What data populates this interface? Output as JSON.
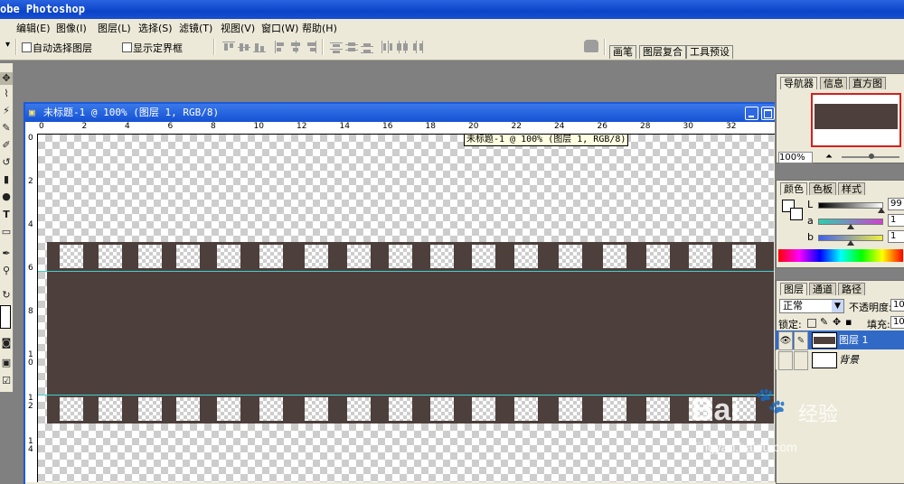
{
  "app": {
    "title": "obe Photoshop"
  },
  "menu": [
    {
      "label": "编辑(E)"
    },
    {
      "label": "图像(I)"
    },
    {
      "label": "图层(L)"
    },
    {
      "label": "选择(S)"
    },
    {
      "label": "滤镜(T)"
    },
    {
      "label": "视图(V)"
    },
    {
      "label": "窗口(W)"
    },
    {
      "label": "帮助(H)"
    }
  ],
  "options": {
    "arrow": "▾",
    "auto_select_label": "自动选择图层",
    "show_bounds_label": "显示定界框",
    "auto_select_checked": false,
    "show_bounds_checked": false
  },
  "well_tabs": [
    "画笔",
    "图层复合",
    "工具预设"
  ],
  "document": {
    "title": "未标题-1 @ 100% (图层 1, RGB/8)",
    "tooltip": "未标题-1 @ 100% (图层 1, RGB/8)",
    "h_ruler": [
      "0",
      "2",
      "4",
      "6",
      "8",
      "10",
      "12",
      "14",
      "16",
      "18",
      "20",
      "22",
      "24",
      "26",
      "28",
      "30",
      "32"
    ],
    "v_ruler": [
      "0",
      "2",
      "4",
      "6",
      "8",
      "1 0",
      "1 2",
      "1 4"
    ],
    "strip_color": "#4d3f3b",
    "guide_color": "#3fd0d0"
  },
  "navigator": {
    "tabs": [
      "导航器",
      "信息",
      "直方图"
    ],
    "zoom": "100%"
  },
  "color_panel": {
    "tabs": [
      "颜色",
      "色板",
      "样式"
    ],
    "channels": [
      {
        "label": "L",
        "value": "99",
        "fraction": 0.99
      },
      {
        "label": "a",
        "value": "1",
        "fraction": 0.5
      },
      {
        "label": "b",
        "value": "1",
        "fraction": 0.5
      }
    ]
  },
  "layers_panel": {
    "tabs": [
      "图层",
      "通道",
      "路径"
    ],
    "blend_mode": "正常",
    "opacity_label": "不透明度:",
    "opacity_value": "10",
    "lock_label": "锁定:",
    "fill_label": "填充:",
    "fill_value": "10",
    "layers": [
      {
        "name": "图层 1",
        "selected": true
      },
      {
        "name": "背景",
        "selected": false
      }
    ]
  },
  "watermark": {
    "brand": "Bai",
    "brand2": "经验",
    "url": "jingyan.baidu.com"
  }
}
